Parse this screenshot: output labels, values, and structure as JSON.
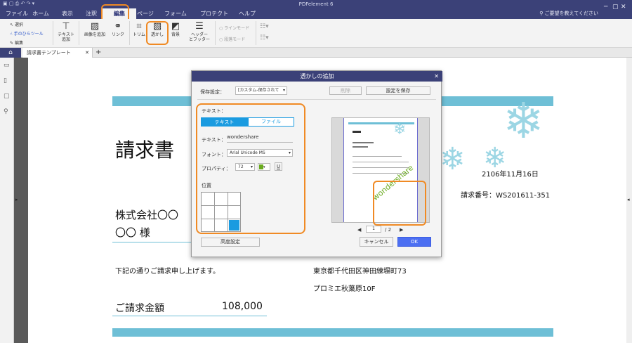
{
  "app": {
    "title": "PDFelement 6",
    "help_text": "ご要望を教えてください"
  },
  "menu": [
    "ファイル",
    "ホーム",
    "表示",
    "注釈",
    "編集",
    "ページ",
    "フォーム",
    "プロテクト",
    "ヘルプ"
  ],
  "ribbon": {
    "select": "選択",
    "hand": "手のひらツール",
    "edit": "編集",
    "add_text_line1": "テキスト",
    "add_text_line2": "追加",
    "add_image": "画像を追加",
    "link": "リンク",
    "trim": "トリム",
    "watermark": "透かし",
    "background": "背景",
    "header_footer_line1": "ヘッダー",
    "header_footer_line2": "とフッター",
    "line_mode": "ラインモード",
    "paragraph_mode": "段落モード"
  },
  "tabs": {
    "doc": "請求書テンプレート",
    "add": "+"
  },
  "doc": {
    "heading": "請求書",
    "company": "株式会社〇〇",
    "recipient": "〇〇 様",
    "date": "2106年11月16日",
    "invoice_no": "請求番号：WS201611-351",
    "intro": "下記の通りご請求申し上げます。",
    "address1": "東京都千代田区神田練塀町73",
    "address2": "プロミエ秋葉原10F",
    "amount_label": "ご請求金額",
    "amount": "108,000"
  },
  "dialog": {
    "title": "透かしの追加",
    "save_settings_label": "保存設定：",
    "preset": "[カスタム-保存されて",
    "delete": "削除",
    "save_settings": "設定を保存",
    "text_section": "テキスト：",
    "tab_text": "テキスト",
    "tab_file": "ファイル",
    "text_label": "テキスト：",
    "text_value": "wondershare",
    "font_label": "フォント：",
    "font_value": "Arial Unicode MS",
    "property_label": "プロパティ：",
    "size_value": "72",
    "underline": "U",
    "position_label": "位置",
    "advanced": "高度設定",
    "page_current": "1",
    "page_total": "/ 2",
    "cancel": "キャンセル",
    "ok": "OK",
    "watermark_preview": "wondershare",
    "colors": {
      "accent": "#1a9be0",
      "watermark": "#6aab1f",
      "ok": "#4c6ff2",
      "highlight": "#f08a24"
    }
  }
}
